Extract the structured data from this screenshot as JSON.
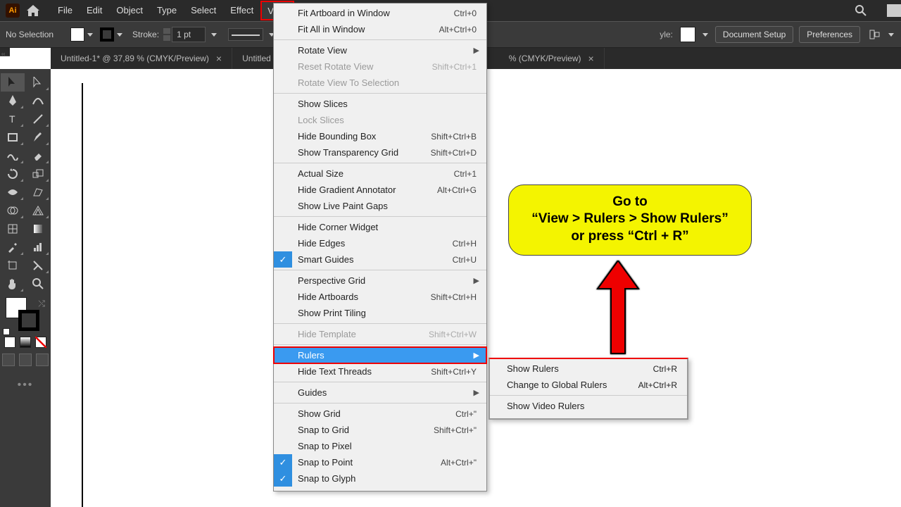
{
  "menubar": {
    "items": [
      "File",
      "Edit",
      "Object",
      "Type",
      "Select",
      "Effect",
      "View"
    ]
  },
  "controlbar": {
    "selection": "No Selection",
    "stroke_label": "Stroke:",
    "stroke_value": "1 pt",
    "style_label": "yle:",
    "doc_setup": "Document Setup",
    "prefs": "Preferences"
  },
  "tabs": {
    "t1": "Untitled-1* @ 37,89 % (CMYK/Preview)",
    "t2_left": "Untitled",
    "t2_right": "% (CMYK/Preview)"
  },
  "viewmenu": [
    {
      "label": "Fit Artboard in Window",
      "sc": "Ctrl+0"
    },
    {
      "label": "Fit All in Window",
      "sc": "Alt+Ctrl+0"
    },
    {
      "sep": true
    },
    {
      "label": "Rotate View",
      "sub": true
    },
    {
      "label": "Reset Rotate View",
      "sc": "Shift+Ctrl+1",
      "dis": true
    },
    {
      "label": "Rotate View To Selection",
      "dis": true
    },
    {
      "sep": true
    },
    {
      "label": "Show Slices"
    },
    {
      "label": "Lock Slices",
      "dis": true
    },
    {
      "label": "Hide Bounding Box",
      "sc": "Shift+Ctrl+B"
    },
    {
      "label": "Show Transparency Grid",
      "sc": "Shift+Ctrl+D"
    },
    {
      "sep": true
    },
    {
      "label": "Actual Size",
      "sc": "Ctrl+1"
    },
    {
      "label": "Hide Gradient Annotator",
      "sc": "Alt+Ctrl+G"
    },
    {
      "label": "Show Live Paint Gaps"
    },
    {
      "sep": true
    },
    {
      "label": "Hide Corner Widget"
    },
    {
      "label": "Hide Edges",
      "sc": "Ctrl+H"
    },
    {
      "label": "Smart Guides",
      "sc": "Ctrl+U",
      "chk": true
    },
    {
      "sep": true
    },
    {
      "label": "Perspective Grid",
      "sub": true
    },
    {
      "label": "Hide Artboards",
      "sc": "Shift+Ctrl+H"
    },
    {
      "label": "Show Print Tiling"
    },
    {
      "sep": true
    },
    {
      "label": "Hide Template",
      "sc": "Shift+Ctrl+W",
      "dis": true
    },
    {
      "sep": true
    },
    {
      "label": "Rulers",
      "sub": true,
      "hl": true
    },
    {
      "label": "Hide Text Threads",
      "sc": "Shift+Ctrl+Y"
    },
    {
      "sep": true
    },
    {
      "label": "Guides",
      "sub": true
    },
    {
      "sep": true
    },
    {
      "label": "Show Grid",
      "sc": "Ctrl+\""
    },
    {
      "label": "Snap to Grid",
      "sc": "Shift+Ctrl+\""
    },
    {
      "label": "Snap to Pixel"
    },
    {
      "label": "Snap to Point",
      "sc": "Alt+Ctrl+\"",
      "chk": true
    },
    {
      "label": "Snap to Glyph",
      "chk": true
    }
  ],
  "submenu": [
    {
      "label": "Show Rulers",
      "sc": "Ctrl+R"
    },
    {
      "label": "Change to Global Rulers",
      "sc": "Alt+Ctrl+R"
    },
    {
      "sep": true
    },
    {
      "label": "Show Video Rulers"
    }
  ],
  "callout": {
    "l1": "Go to",
    "l2": "“View > Rulers > Show Rulers”",
    "l3": "or press “Ctrl + R”"
  }
}
